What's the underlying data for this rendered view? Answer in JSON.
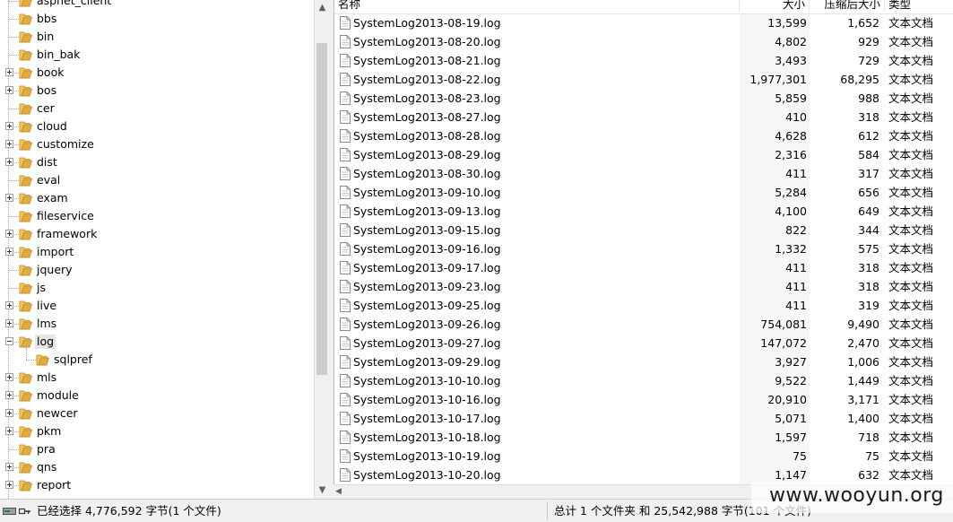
{
  "tree": {
    "items": [
      {
        "label": "aspnet_client",
        "expandable": false
      },
      {
        "label": "bbs",
        "expandable": false
      },
      {
        "label": "bin",
        "expandable": false
      },
      {
        "label": "bin_bak",
        "expandable": false
      },
      {
        "label": "book",
        "expandable": true
      },
      {
        "label": "bos",
        "expandable": true
      },
      {
        "label": "cer",
        "expandable": false
      },
      {
        "label": "cloud",
        "expandable": true
      },
      {
        "label": "customize",
        "expandable": true
      },
      {
        "label": "dist",
        "expandable": true
      },
      {
        "label": "eval",
        "expandable": false
      },
      {
        "label": "exam",
        "expandable": true
      },
      {
        "label": "fileservice",
        "expandable": false
      },
      {
        "label": "framework",
        "expandable": true
      },
      {
        "label": "import",
        "expandable": true
      },
      {
        "label": "jquery",
        "expandable": false
      },
      {
        "label": "js",
        "expandable": false
      },
      {
        "label": "live",
        "expandable": true
      },
      {
        "label": "lms",
        "expandable": true
      },
      {
        "label": "log",
        "expandable": true,
        "expanded": true,
        "selected": true
      },
      {
        "label": "sqlpref",
        "expandable": false,
        "child": true
      },
      {
        "label": "mls",
        "expandable": true
      },
      {
        "label": "module",
        "expandable": true
      },
      {
        "label": "newcer",
        "expandable": true
      },
      {
        "label": "pkm",
        "expandable": true
      },
      {
        "label": "pra",
        "expandable": false
      },
      {
        "label": "qns",
        "expandable": true
      },
      {
        "label": "report",
        "expandable": true
      }
    ]
  },
  "list": {
    "headers": {
      "name": "名称",
      "size": "大小",
      "compressed": "压缩后大小",
      "type": "类型"
    },
    "rows": [
      {
        "name": "SystemLog2013-08-19.log",
        "size": "13,599",
        "compressed": "1,652",
        "type": "文本文档"
      },
      {
        "name": "SystemLog2013-08-20.log",
        "size": "4,802",
        "compressed": "929",
        "type": "文本文档"
      },
      {
        "name": "SystemLog2013-08-21.log",
        "size": "3,493",
        "compressed": "729",
        "type": "文本文档"
      },
      {
        "name": "SystemLog2013-08-22.log",
        "size": "1,977,301",
        "compressed": "68,295",
        "type": "文本文档"
      },
      {
        "name": "SystemLog2013-08-23.log",
        "size": "5,859",
        "compressed": "988",
        "type": "文本文档"
      },
      {
        "name": "SystemLog2013-08-27.log",
        "size": "410",
        "compressed": "318",
        "type": "文本文档"
      },
      {
        "name": "SystemLog2013-08-28.log",
        "size": "4,628",
        "compressed": "612",
        "type": "文本文档"
      },
      {
        "name": "SystemLog2013-08-29.log",
        "size": "2,316",
        "compressed": "584",
        "type": "文本文档"
      },
      {
        "name": "SystemLog2013-08-30.log",
        "size": "411",
        "compressed": "317",
        "type": "文本文档"
      },
      {
        "name": "SystemLog2013-09-10.log",
        "size": "5,284",
        "compressed": "656",
        "type": "文本文档"
      },
      {
        "name": "SystemLog2013-09-13.log",
        "size": "4,100",
        "compressed": "649",
        "type": "文本文档"
      },
      {
        "name": "SystemLog2013-09-15.log",
        "size": "822",
        "compressed": "344",
        "type": "文本文档"
      },
      {
        "name": "SystemLog2013-09-16.log",
        "size": "1,332",
        "compressed": "575",
        "type": "文本文档"
      },
      {
        "name": "SystemLog2013-09-17.log",
        "size": "411",
        "compressed": "318",
        "type": "文本文档"
      },
      {
        "name": "SystemLog2013-09-23.log",
        "size": "411",
        "compressed": "318",
        "type": "文本文档"
      },
      {
        "name": "SystemLog2013-09-25.log",
        "size": "411",
        "compressed": "319",
        "type": "文本文档"
      },
      {
        "name": "SystemLog2013-09-26.log",
        "size": "754,081",
        "compressed": "9,490",
        "type": "文本文档"
      },
      {
        "name": "SystemLog2013-09-27.log",
        "size": "147,072",
        "compressed": "2,470",
        "type": "文本文档"
      },
      {
        "name": "SystemLog2013-09-29.log",
        "size": "3,927",
        "compressed": "1,006",
        "type": "文本文档"
      },
      {
        "name": "SystemLog2013-10-10.log",
        "size": "9,522",
        "compressed": "1,449",
        "type": "文本文档"
      },
      {
        "name": "SystemLog2013-10-16.log",
        "size": "20,910",
        "compressed": "3,171",
        "type": "文本文档"
      },
      {
        "name": "SystemLog2013-10-17.log",
        "size": "5,071",
        "compressed": "1,400",
        "type": "文本文档"
      },
      {
        "name": "SystemLog2013-10-18.log",
        "size": "1,597",
        "compressed": "718",
        "type": "文本文档"
      },
      {
        "name": "SystemLog2013-10-19.log",
        "size": "75",
        "compressed": "75",
        "type": "文本文档"
      },
      {
        "name": "SystemLog2013-10-20.log",
        "size": "1,147",
        "compressed": "632",
        "type": "文本文档"
      }
    ]
  },
  "status": {
    "selected_text": "已经选择 4,776,592 字节(1 个文件)",
    "total_text": "总计 1 个文件夹 和 25,542,988 字节(101 个文件)"
  },
  "watermark": "www.wooyun.org",
  "icons": {
    "folder": "folder-icon",
    "file": "text-file-icon",
    "status": "drive-key-icon"
  },
  "colors": {
    "folder": "#e8b84a",
    "selected_bg": "#e5e5e5"
  }
}
